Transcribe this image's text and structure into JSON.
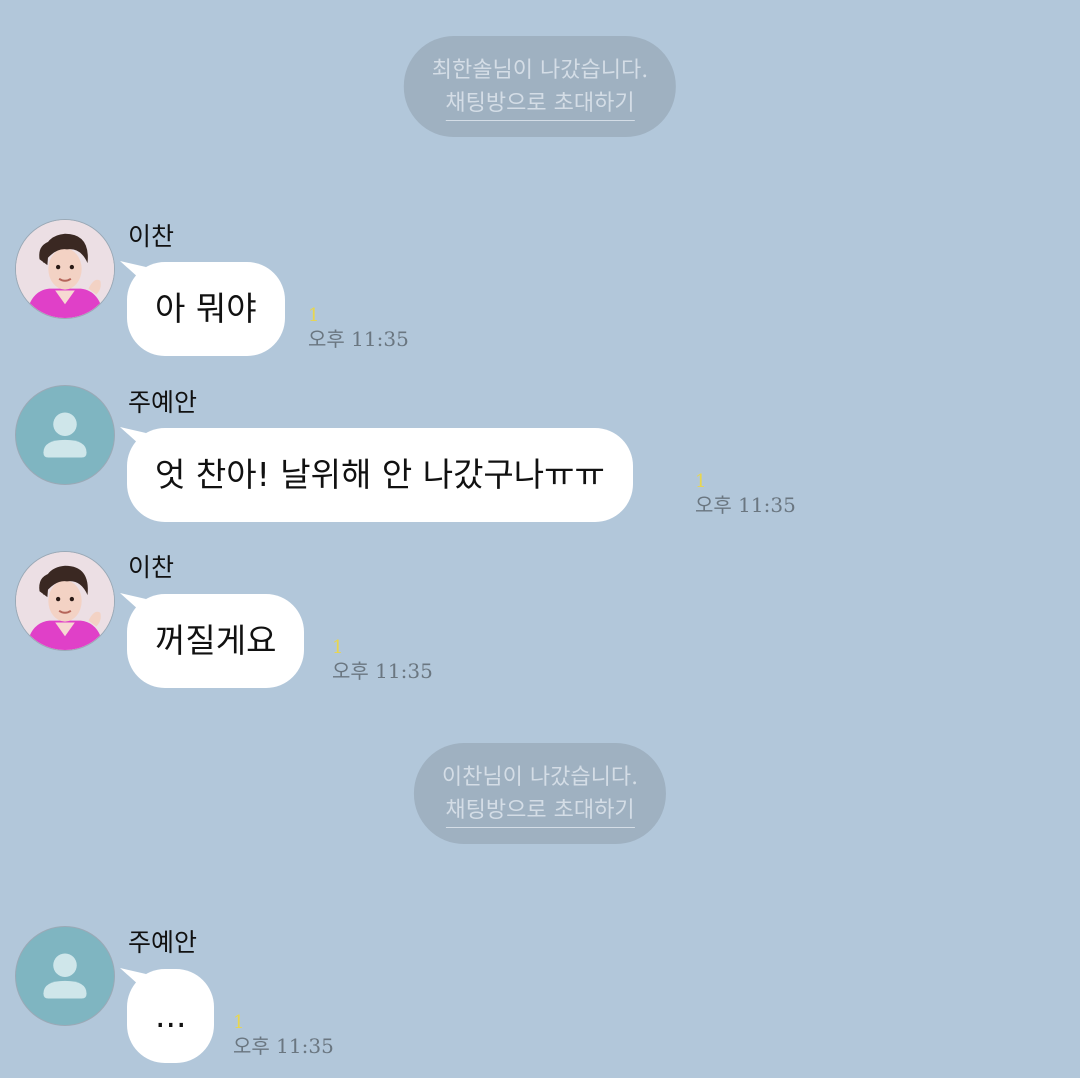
{
  "notices": [
    {
      "text": "최한솔님이 나갔습니다.",
      "invite_label": "채팅방으로 초대하기"
    },
    {
      "text": "이찬님이 나갔습니다.",
      "invite_label": "채팅방으로 초대하기"
    }
  ],
  "messages": [
    {
      "sender": "이찬",
      "text": "아 뭐야",
      "unread": "1",
      "time": "오후 11:35",
      "avatar": "photo-avatar"
    },
    {
      "sender": "주예안",
      "text": "엇 찬아! 날위해 안 나갔구나ㅠㅠ",
      "unread": "1",
      "time": "오후 11:35",
      "avatar": "default-profile-icon"
    },
    {
      "sender": "이찬",
      "text": "꺼질게요",
      "unread": "1",
      "time": "오후 11:35",
      "avatar": "photo-avatar"
    },
    {
      "sender": "주예안",
      "text": "...",
      "unread": "1",
      "time": "오후 11:35",
      "avatar": "default-profile-icon"
    }
  ],
  "colors": {
    "background": "#b2c7da",
    "bubble": "#ffffff",
    "notice_bg": "#9fb1c1",
    "unread": "#e8d64f",
    "default_avatar": "#7fb5c1"
  }
}
